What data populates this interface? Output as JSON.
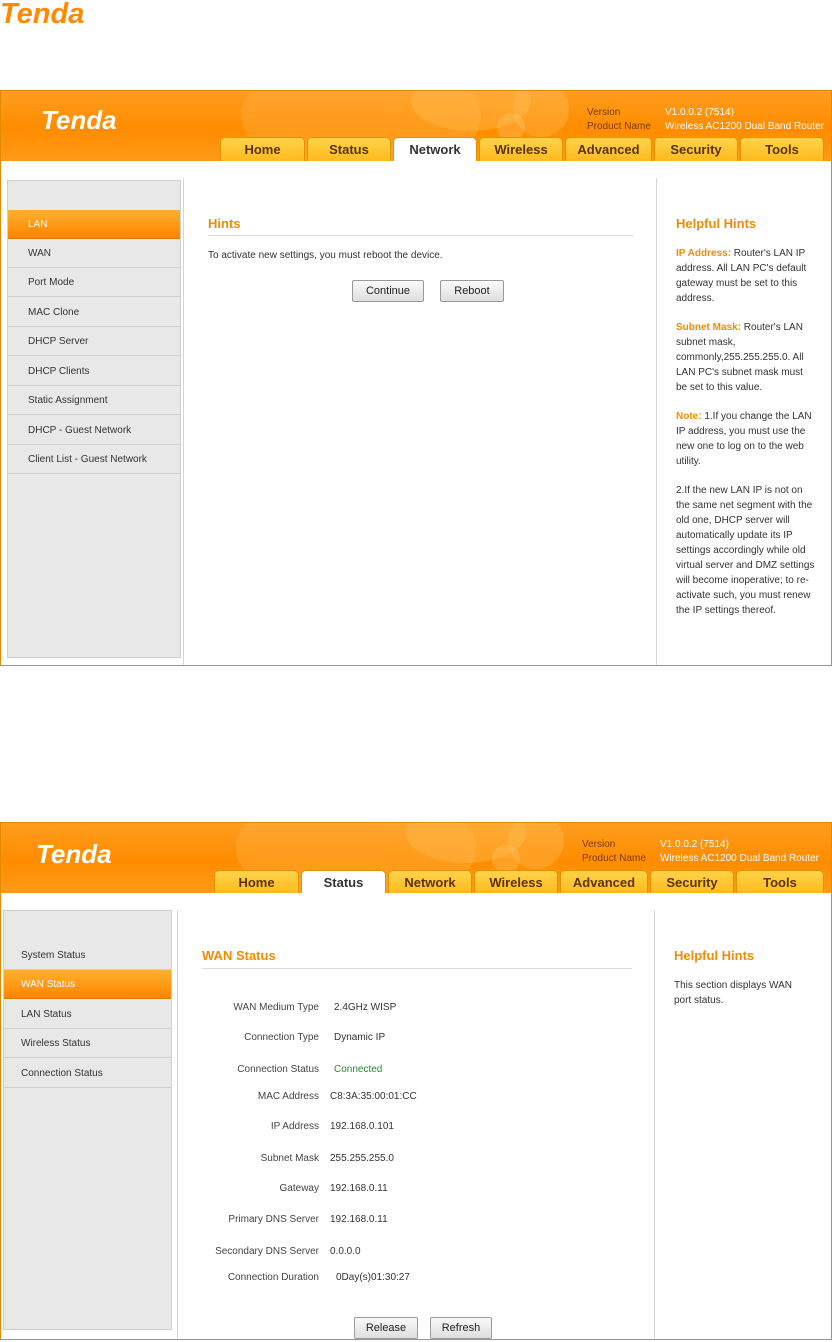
{
  "brand": {
    "name": "Tenda",
    "doc_logo_color": "#ff8a00"
  },
  "header": {
    "version_label": "Version",
    "version_value": "V1.0.0.2 (7514)",
    "product_label": "Product Name",
    "product_value": "Wireless AC1200 Dual Band Router",
    "accent": "#ff9000"
  },
  "tabs": [
    "Home",
    "Status",
    "Network",
    "Wireless",
    "Advanced",
    "Security",
    "Tools"
  ],
  "screen1": {
    "active_tab": "Network",
    "sidebar": [
      "LAN",
      "WAN",
      "Port Mode",
      "MAC Clone",
      "DHCP Server",
      "DHCP Clients",
      "Static Assignment",
      "DHCP - Guest Network",
      "Client List - Guest Network"
    ],
    "active_item": "LAN",
    "title": "Hints",
    "message": "To activate new settings, you must reboot the device.",
    "continue_label": "Continue",
    "reboot_label": "Reboot",
    "hints_title": "Helpful Hints",
    "hints": [
      {
        "label": "IP Address:",
        "text": " Router's LAN IP address. All LAN PC's default gateway must be set to this address."
      },
      {
        "label": "Subnet Mask:",
        "text": " Router's LAN subnet mask, commonly,255.255.255.0. All LAN PC's subnet mask must be set to this value."
      },
      {
        "label": "Note:",
        "text": " 1.If you change the LAN IP address, you must use the new one to log on to the web utility."
      },
      {
        "label": "",
        "text": "2.If the new LAN IP is not on the same net segment with the old one, DHCP server will automatically update its IP settings accordingly while old virtual server and DMZ settings will become inoperative; to re-activate such, you must renew the IP settings thereof."
      }
    ]
  },
  "screen2": {
    "active_tab": "Status",
    "sidebar": [
      "System Status",
      "WAN Status",
      "LAN Status",
      "Wireless Status",
      "Connection Status"
    ],
    "active_item": "WAN Status",
    "title": "WAN Status",
    "fields": [
      {
        "label": "WAN Medium Type",
        "value": "2.4GHz WISP"
      },
      {
        "label": "Connection Type",
        "value": "Dynamic IP"
      },
      {
        "label": "Connection Status",
        "value": "Connected"
      },
      {
        "label": "MAC Address",
        "value": "C8:3A:35:00:01:CC"
      },
      {
        "label": "IP Address",
        "value": "192.168.0.101"
      },
      {
        "label": "Subnet Mask",
        "value": "255.255.255.0"
      },
      {
        "label": "Gateway",
        "value": "192.168.0.11"
      },
      {
        "label": "Primary DNS Server",
        "value": "192.168.0.11"
      },
      {
        "label": "Secondary DNS Server",
        "value": "0.0.0.0"
      },
      {
        "label": "Connection Duration",
        "value": "0Day(s)01:30:27"
      }
    ],
    "release_label": "Release",
    "refresh_label": "Refresh",
    "hints_title": "Helpful Hints",
    "hint_text": "This section displays WAN port status."
  }
}
